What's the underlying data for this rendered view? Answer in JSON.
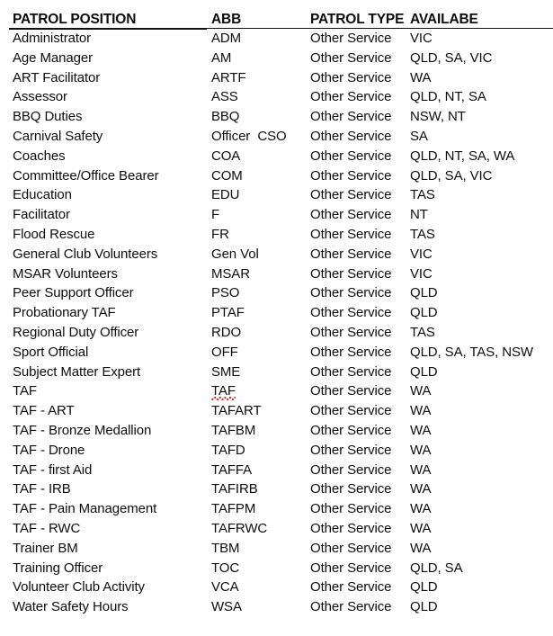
{
  "document": {
    "background_color": "#ffffff",
    "text_color": "#0d0d0d",
    "spellcheck_underline_color": "#e02020"
  },
  "table": {
    "columns": [
      {
        "key": "position",
        "label": "PATROL POSITION"
      },
      {
        "key": "abb",
        "label": "ABB"
      },
      {
        "key": "type",
        "label": "PATROL TYPE"
      },
      {
        "key": "avail",
        "label": "AVAILABE"
      }
    ],
    "rows": [
      {
        "position": "Administrator",
        "abb": "ADM",
        "type": "Other Service",
        "avail": "VIC"
      },
      {
        "position": "Age Manager",
        "abb": "AM",
        "type": "Other Service",
        "avail": "QLD, SA, VIC"
      },
      {
        "position": "ART Facilitator",
        "abb": "ARTF",
        "type": "Other Service",
        "avail": "WA"
      },
      {
        "position": "Assessor",
        "abb": "ASS",
        "type": "Other Service",
        "avail": "QLD, NT, SA"
      },
      {
        "position": "BBQ Duties",
        "abb": "BBQ",
        "type": "Other Service",
        "avail": "NSW, NT"
      },
      {
        "position": "Carnival Safety",
        "abb": "Officer  CSO",
        "type": "Other Service",
        "avail": "SA"
      },
      {
        "position": "Coaches",
        "abb": "COA",
        "type": "Other Service",
        "avail": "QLD, NT, SA, WA"
      },
      {
        "position": "Committee/Office Bearer",
        "abb": "COM",
        "type": "Other Service",
        "avail": "QLD, SA, VIC"
      },
      {
        "position": "Education",
        "abb": "EDU",
        "type": "Other Service",
        "avail": "TAS"
      },
      {
        "position": "Facilitator",
        "abb": "F",
        "type": "Other Service",
        "avail": "NT"
      },
      {
        "position": "Flood Rescue",
        "abb": "FR",
        "type": "Other Service",
        "avail": "TAS"
      },
      {
        "position": "General Club Volunteers",
        "abb": "Gen Vol",
        "type": "Other Service",
        "avail": "VIC"
      },
      {
        "position": "MSAR Volunteers",
        "abb": "MSAR",
        "type": "Other Service",
        "avail": "VIC"
      },
      {
        "position": "Peer Support Officer",
        "abb": "PSO",
        "type": "Other Service",
        "avail": "QLD"
      },
      {
        "position": "Probationary TAF",
        "abb": "PTAF",
        "type": "Other Service",
        "avail": "QLD"
      },
      {
        "position": "Regional Duty Officer",
        "abb": "RDO",
        "type": "Other Service",
        "avail": "TAS"
      },
      {
        "position": "Sport Official",
        "abb": "OFF",
        "type": "Other Service",
        "avail": "QLD, SA, TAS, NSW"
      },
      {
        "position": "Subject Matter Expert",
        "abb": "SME",
        "type": "Other Service",
        "avail": "QLD"
      },
      {
        "position": "TAF",
        "abb": "TAF",
        "type": "Other Service",
        "avail": "WA",
        "abb_spellcheck": true
      },
      {
        "position": "TAF - ART",
        "abb": "TAFART",
        "type": "Other Service",
        "avail": "WA"
      },
      {
        "position": "TAF - Bronze Medallion",
        "abb": "TAFBM",
        "type": "Other Service",
        "avail": "WA"
      },
      {
        "position": "TAF - Drone",
        "abb": "TAFD",
        "type": "Other Service",
        "avail": "WA"
      },
      {
        "position": "TAF - first Aid",
        "abb": "TAFFA",
        "type": "Other Service",
        "avail": "WA"
      },
      {
        "position": "TAF - IRB",
        "abb": "TAFIRB",
        "type": "Other Service",
        "avail": "WA"
      },
      {
        "position": "TAF - Pain Management",
        "abb": "TAFPM",
        "type": "Other Service",
        "avail": "WA"
      },
      {
        "position": "TAF - RWC",
        "abb": "TAFRWC",
        "type": "Other Service",
        "avail": "WA"
      },
      {
        "position": "Trainer BM",
        "abb": "TBM",
        "type": "Other Service",
        "avail": "WA"
      },
      {
        "position": "Training Officer",
        "abb": "TOC",
        "type": "Other Service",
        "avail": "QLD, SA"
      },
      {
        "position": "Volunteer Club Activity",
        "abb": "VCA",
        "type": "Other Service",
        "avail": "QLD"
      },
      {
        "position": "Water Safety Hours",
        "abb": "WSA",
        "type": "Other Service",
        "avail": "QLD"
      }
    ]
  }
}
